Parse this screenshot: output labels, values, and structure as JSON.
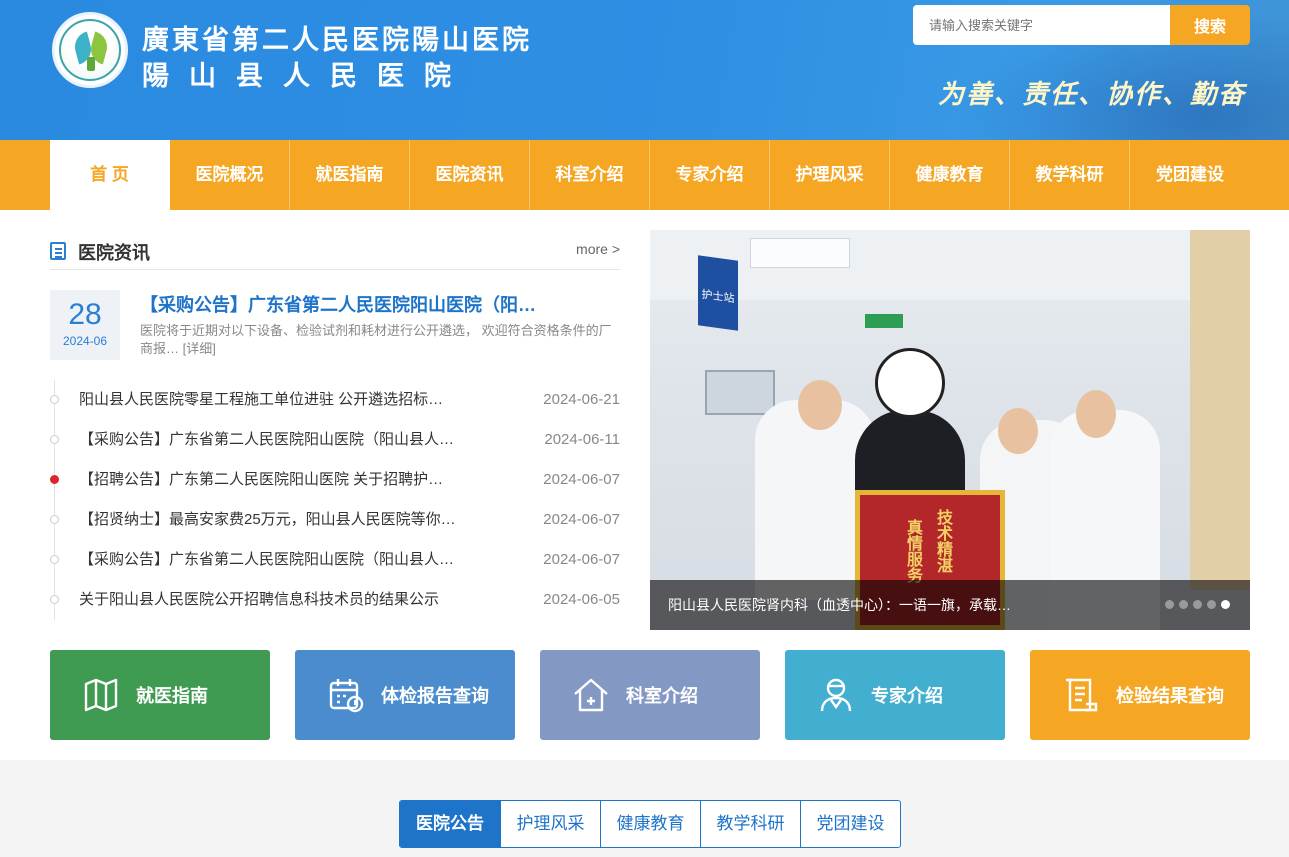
{
  "header": {
    "name_line1": "廣東省第二人民医院陽山医院",
    "name_line2": "陽山县人民医院",
    "motto": "为善、责任、协作、勤奋",
    "search": {
      "placeholder": "请输入搜索关键字",
      "button_label": "搜索"
    }
  },
  "nav": {
    "items": [
      "首 页",
      "医院概况",
      "就医指南",
      "医院资讯",
      "科室介绍",
      "专家介绍",
      "护理风采",
      "健康教育",
      "教学科研",
      "党团建设"
    ],
    "active_index": 0
  },
  "news": {
    "title": "医院资讯",
    "more": "more >",
    "featured": {
      "day": "28",
      "year_month": "2024-06",
      "title": "【采购公告】广东省第二人民医院阳山医院（阳…",
      "summary": "医院将于近期对以下设备、检验试剂和耗材进行公开遴选， 欢迎符合资格条件的厂商报… [详细]"
    },
    "items": [
      {
        "title": "阳山县人民医院零星工程施工单位进驻 公开遴选招标…",
        "date": "2024-06-21",
        "highlight": false
      },
      {
        "title": "【采购公告】广东省第二人民医院阳山医院（阳山县人…",
        "date": "2024-06-11",
        "highlight": false
      },
      {
        "title": "【招聘公告】广东第二人民医院阳山医院 关于招聘护…",
        "date": "2024-06-07",
        "highlight": true
      },
      {
        "title": "【招贤纳士】最高安家费25万元，阳山县人民医院等你…",
        "date": "2024-06-07",
        "highlight": false
      },
      {
        "title": "【采购公告】广东省第二人民医院阳山医院（阳山县人…",
        "date": "2024-06-07",
        "highlight": false
      },
      {
        "title": "关于阳山县人民医院公开招聘信息科技术员的结果公示",
        "date": "2024-06-05",
        "highlight": false
      }
    ]
  },
  "slider": {
    "caption": "阳山县人民医院肾内科（血透中心）：一语一旗，承载…",
    "sign_text": "护士站",
    "banner_text": [
      "技术精湛",
      "真情服务"
    ],
    "slide_count": 5,
    "active_slide": 4
  },
  "quick_links": [
    {
      "label": "就医指南",
      "icon": "map-icon",
      "color": "#3f9a52"
    },
    {
      "label": "体检报告查询",
      "icon": "calendar-icon",
      "color": "#4a8ccd"
    },
    {
      "label": "科室介绍",
      "icon": "house-plus-icon",
      "color": "#8498c4"
    },
    {
      "label": "专家介绍",
      "icon": "doctor-icon",
      "color": "#42aed0"
    },
    {
      "label": "检验结果查询",
      "icon": "document-icon",
      "color": "#f5a623"
    }
  ],
  "bottom_tabs": {
    "items": [
      "医院公告",
      "护理风采",
      "健康教育",
      "教学科研",
      "党团建设"
    ],
    "active_index": 0
  }
}
